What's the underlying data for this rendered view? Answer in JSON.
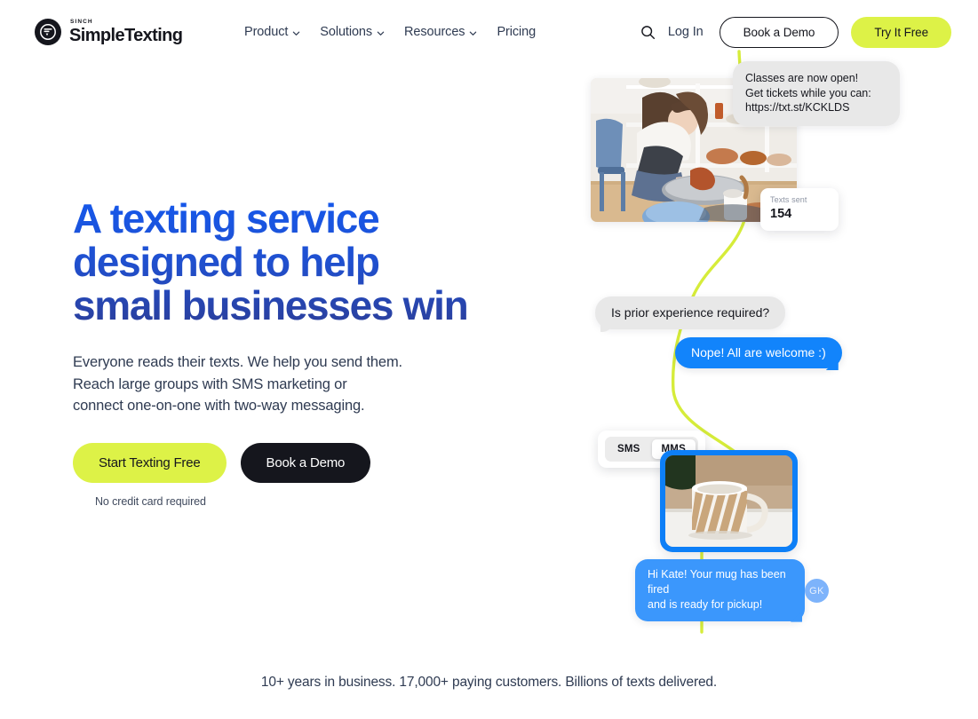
{
  "header": {
    "logo": {
      "icon": "speech-bubble-logo-icon",
      "eyebrow": "SINCH",
      "name": "SimpleTexting"
    },
    "nav": [
      {
        "label": "Product",
        "has_chevron": true
      },
      {
        "label": "Solutions",
        "has_chevron": true
      },
      {
        "label": "Resources",
        "has_chevron": true
      },
      {
        "label": "Pricing",
        "has_chevron": false
      }
    ],
    "search_icon": "search-icon",
    "login_label": "Log In",
    "book_demo_label": "Book a Demo",
    "try_free_label": "Try It Free"
  },
  "hero": {
    "title": "A texting service\ndesigned to help\nsmall businesses win",
    "subtitle": "Everyone reads their texts. We help you send them.\nReach large groups with SMS marketing or\nconnect one-on-one with two-way messaging.",
    "cta_primary": "Start Texting Free",
    "cta_secondary": "Book a Demo",
    "cta_note": "No credit card required"
  },
  "artwork": {
    "photo_alt": "woman-at-pottery-wheel-photo",
    "bubble_top": "Classes are now open!\nGet tickets while you can:\nhttps://txt.st/KCKLDS",
    "stat_card": {
      "label": "Texts sent",
      "value": "154"
    },
    "bubble_question": "Is prior experience required?",
    "bubble_answer": "Nope! All are welcome :)",
    "toggle": {
      "options": [
        "SMS",
        "MMS"
      ],
      "selected": "MMS"
    },
    "mms_image_alt": "striped-ceramic-mug-photo",
    "bubble_pickup": "Hi Kate! Your mug has been fired\nand is ready for pickup!",
    "avatar_initials": "GK"
  },
  "strip": {
    "text": "10+ years in business. 17,000+ paying customers. Billions of texts delivered."
  },
  "colors": {
    "lime": "#ddf247",
    "dark": "#15161d",
    "brand_blue": "#1558ec",
    "bubble_blue": "#1284fb",
    "bubble_blue_light": "#3b97fc",
    "bubble_grey": "#e8e8e8",
    "squiggle": "#d6ec3a"
  }
}
